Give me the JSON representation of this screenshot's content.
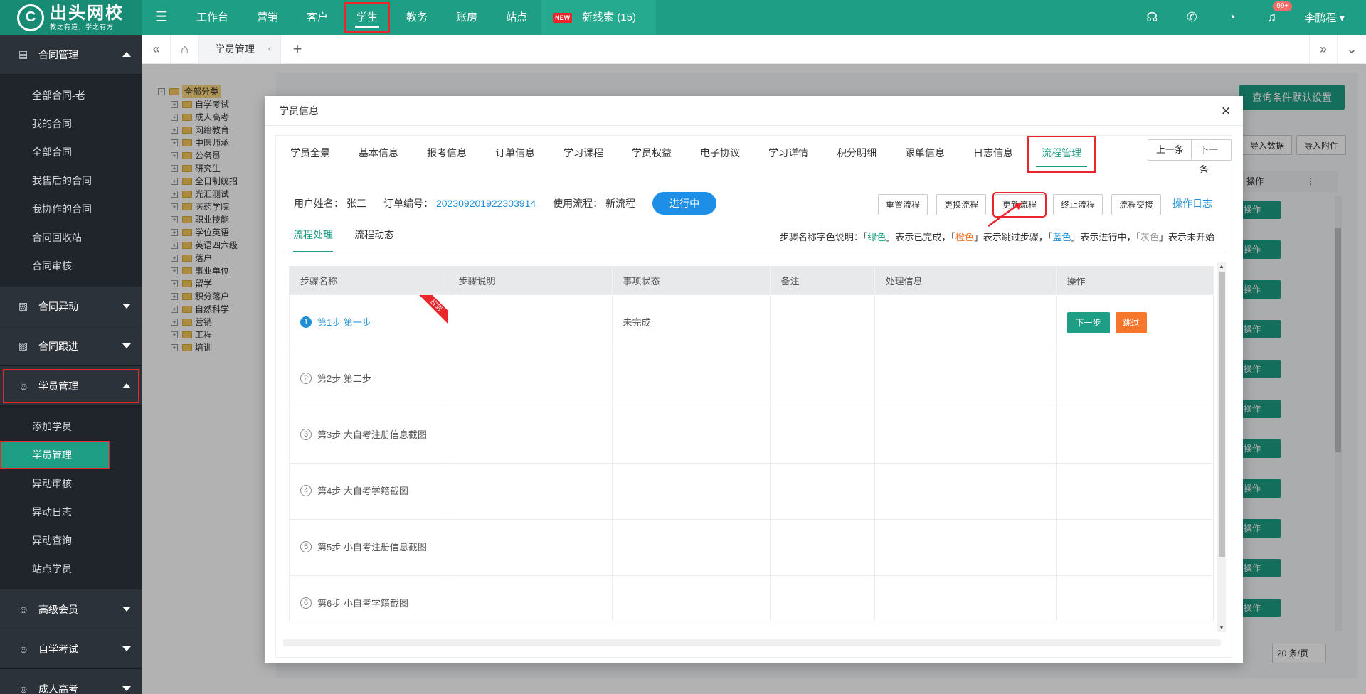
{
  "topbar": {
    "logo_mark": "C",
    "logo_name": "出头网校",
    "logo_slogan": "教之有道，学之有方",
    "nav": [
      "工作台",
      "营销",
      "客户",
      "学生",
      "教务",
      "账房",
      "站点"
    ],
    "new_badge": "NEW",
    "special_item": "新线索 (15)",
    "notification_count": "99+",
    "user_name": "李鹏程"
  },
  "sidebar": {
    "contract_group": "合同管理",
    "contract_items": [
      "全部合同-老",
      "我的合同",
      "全部合同",
      "我售后的合同",
      "我协作的合同",
      "合同回收站",
      "合同审核"
    ],
    "contract_change": "合同异动",
    "contract_follow": "合同跟进",
    "student_group": "学员管理",
    "student_items": [
      "添加学员",
      "学员管理",
      "异动审核",
      "异动日志",
      "异动查询",
      "站点学员"
    ],
    "vip_group": "高级会员",
    "selfexam_group": "自学考试",
    "adult_group": "成人高考"
  },
  "tabbar": {
    "page_tab": "学员管理",
    "close": "×",
    "add": "+"
  },
  "background": {
    "tree_root": "全部分类",
    "tree_items": [
      "自学考试",
      "成人高考",
      "网络教育",
      "中医师承",
      "公务员",
      "研究生",
      "全日制统招",
      "光汇测试",
      "医药学院",
      "职业技能",
      "学位英语",
      "英语四六级",
      "落户",
      "事业单位",
      "留学",
      "积分落户",
      "自然科学",
      "营销",
      "工程",
      "培训"
    ],
    "default_query_btn": "查询条件默认设置",
    "import_data": "导入数据",
    "import_attach": "导入附件",
    "op_col": "操作",
    "op_btn": "操作",
    "pager_per": "20 条/页"
  },
  "modal": {
    "title": "学员信息",
    "tabs": [
      "学员全景",
      "基本信息",
      "报考信息",
      "订单信息",
      "学习课程",
      "学员权益",
      "电子协议",
      "学习详情",
      "积分明细",
      "跟单信息",
      "日志信息",
      "流程管理"
    ],
    "prev": "上一条",
    "next": "下一条",
    "user_label": "用户姓名：",
    "user_value": "张三",
    "order_label": "订单编号：",
    "order_value": "20230920192230391​4",
    "flow_label": "使用流程：",
    "flow_value": "新流程",
    "status": "进行中",
    "actions": [
      "重置流程",
      "更换流程",
      "更新流程",
      "终止流程",
      "流程交接"
    ],
    "log_link": "操作日志",
    "subtabs": [
      "流程处理",
      "流程动态"
    ],
    "legend": {
      "prefix": "步骤名称字色说明：「",
      "green": "绿色",
      "green_desc": "」表示已完成，「",
      "orange": "橙色",
      "orange_desc": "」表示跳过步骤，「",
      "blue": "蓝色",
      "blue_desc": "」表示进行中，「",
      "gray": "灰色",
      "gray_desc": "」表示未开始"
    },
    "columns": [
      "步骤名称",
      "步骤说明",
      "事项状态",
      "备注",
      "处理信息",
      "操作"
    ],
    "ribbon": "应到",
    "steps": [
      {
        "num": "1",
        "name": "第1步  第一步",
        "status": "未完成"
      },
      {
        "num": "2",
        "name": "第2步  第二步",
        "status": ""
      },
      {
        "num": "3",
        "name": "第3步  大自考注册信息截图",
        "status": ""
      },
      {
        "num": "4",
        "name": "第4步  大自考学籍截图",
        "status": ""
      },
      {
        "num": "5",
        "name": "第5步  小自考注册信息截图",
        "status": ""
      },
      {
        "num": "6",
        "name": "第6步  小自考学籍截图",
        "status": ""
      }
    ],
    "btn_next": "下一步",
    "btn_skip": "跳过"
  }
}
